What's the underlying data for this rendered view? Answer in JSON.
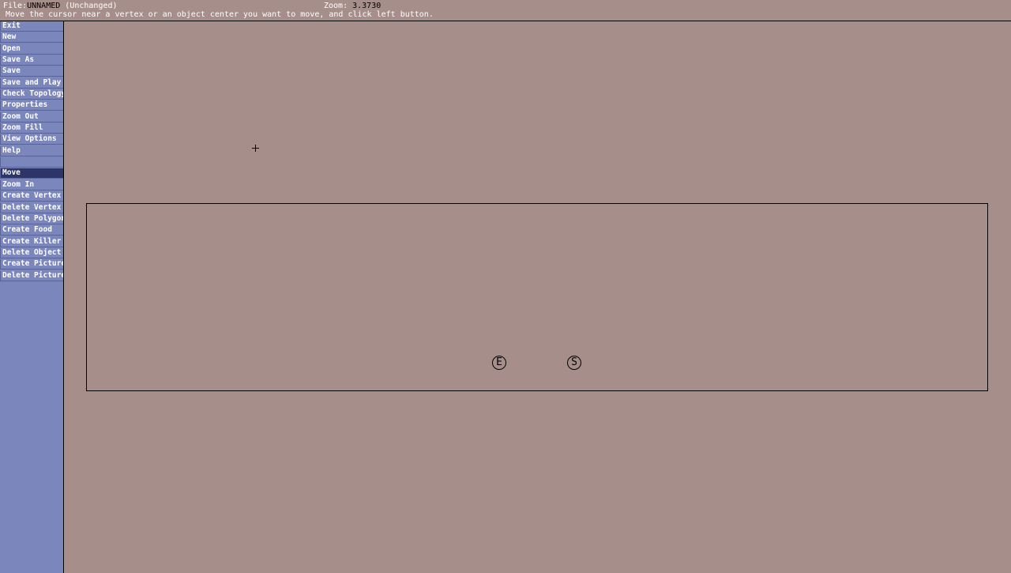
{
  "header": {
    "file_label": "File:",
    "file_name": "UNNAMED",
    "file_state": "(Unchanged)",
    "zoom_label": "Zoom: ",
    "zoom_value": "3.3730",
    "status": "Move the cursor near a vertex or an object center you want to move, and click left button."
  },
  "menu": {
    "items": [
      "Exit",
      "New",
      "Open",
      "Save As",
      "Save",
      "Save and Play",
      "Check Topology",
      "Properties",
      "Zoom Out",
      "Zoom Fill",
      "View Options",
      "Help"
    ],
    "tools": [
      "Move",
      "Zoom In",
      "Create Vertex",
      "Delete Vertex",
      "Delete Polygon",
      "Create Food",
      "Create Killer",
      "Delete Object",
      "Create Picture",
      "Delete Picture"
    ],
    "active_tool": "Move"
  },
  "canvas": {
    "objects": [
      {
        "label": "E"
      },
      {
        "label": "S"
      }
    ]
  },
  "colors": {
    "background": "#a68f8a",
    "sidebar": "#7b86bd",
    "active": "#2c3468"
  }
}
